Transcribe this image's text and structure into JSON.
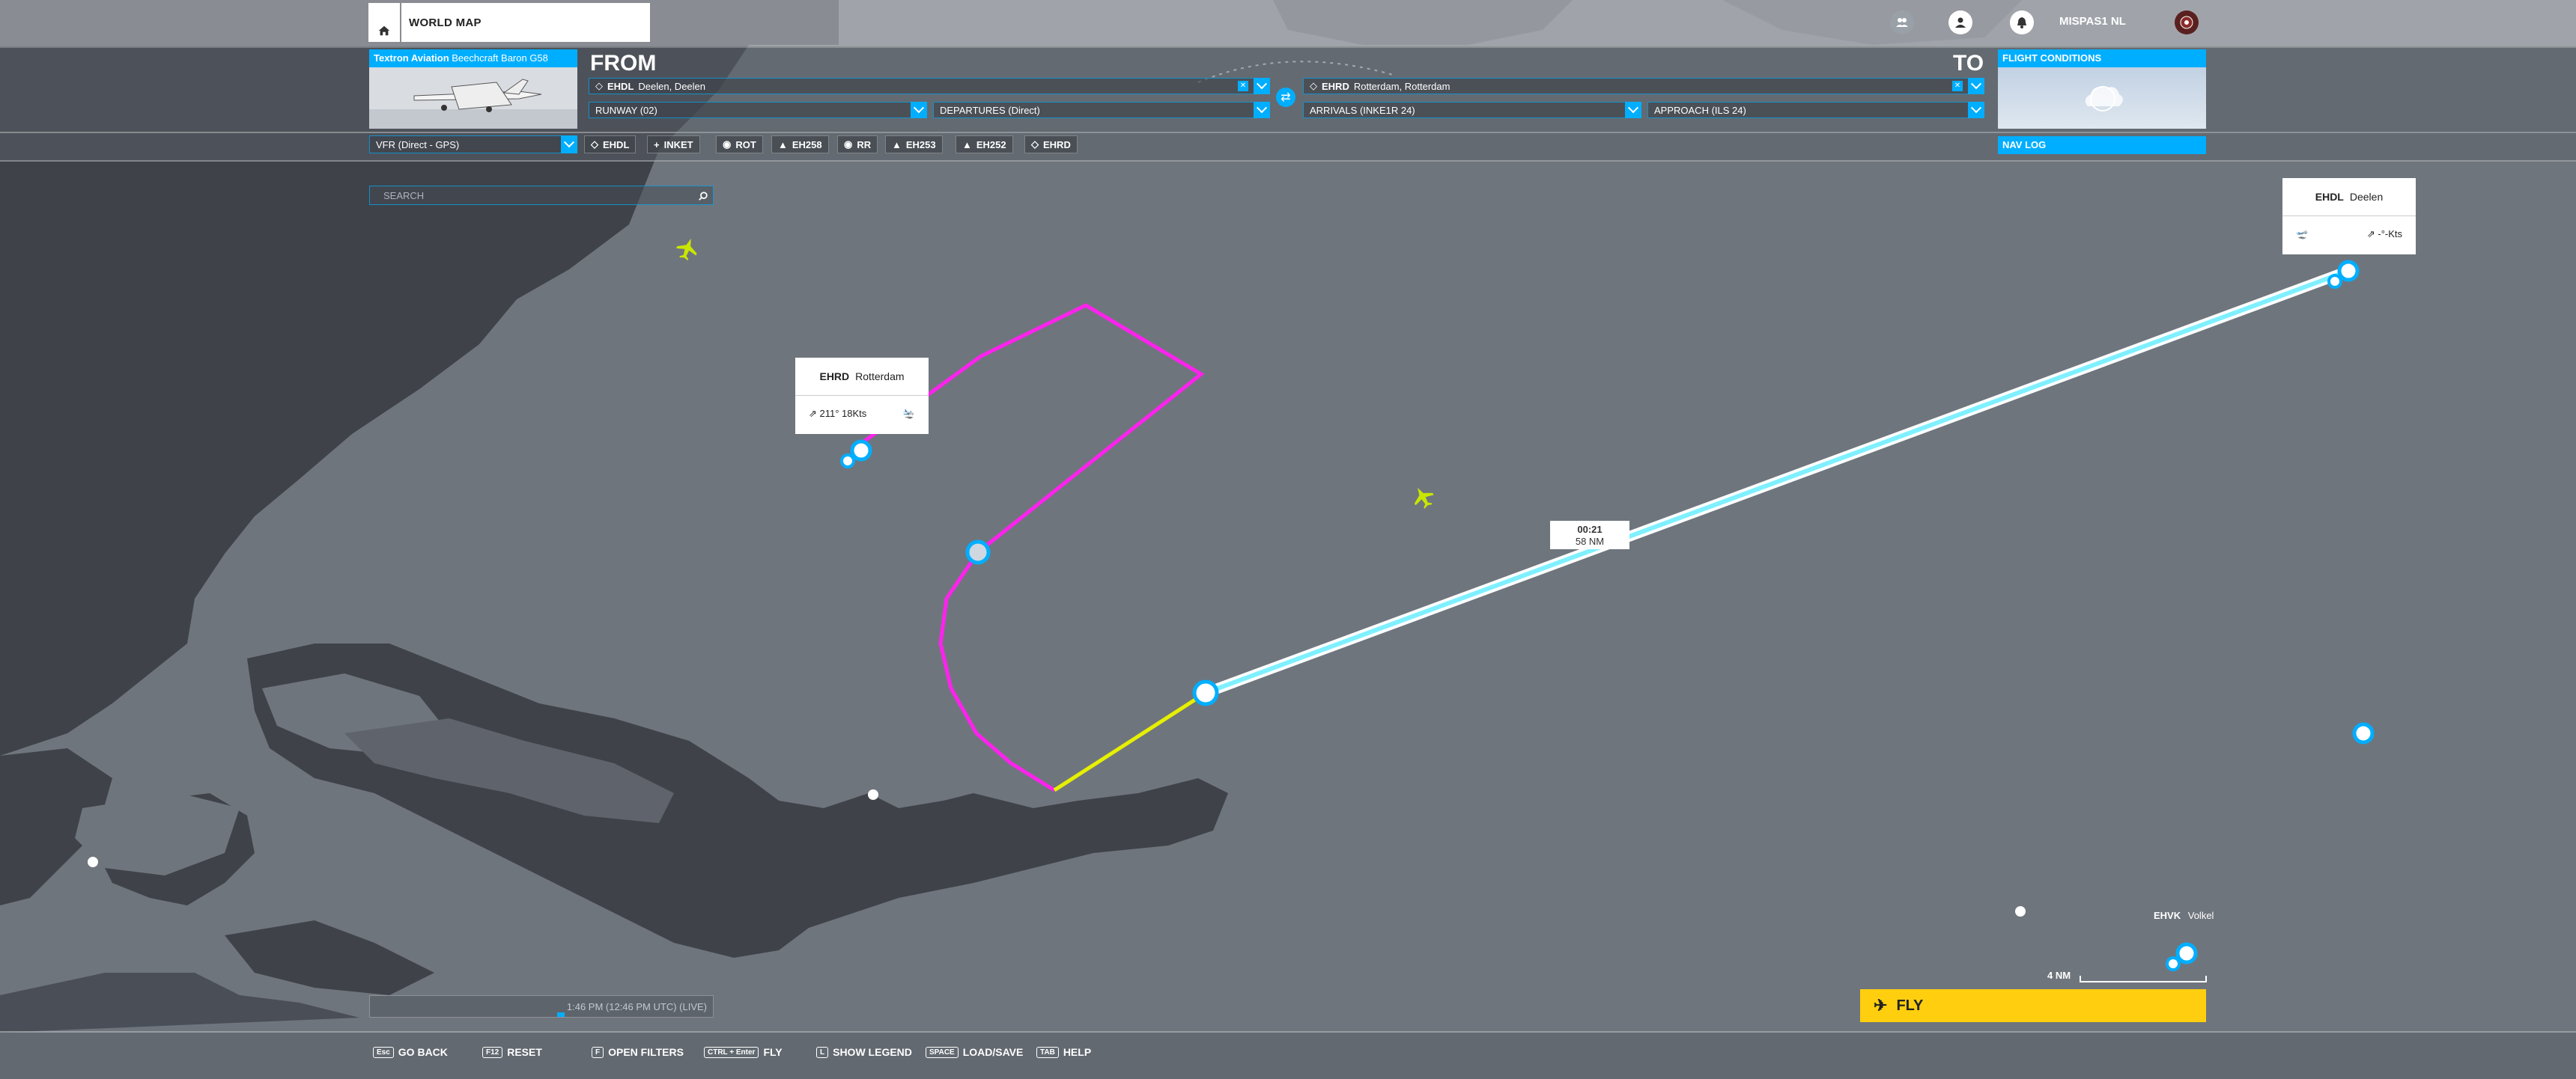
{
  "top": {
    "tab_label": "WORLD MAP",
    "pilot_name": "MISPAS1 NL"
  },
  "aircraft": {
    "maker": "Textron Aviation",
    "model": "Beechcraft Baron G58"
  },
  "from": {
    "title": "FROM",
    "airport_code": "EHDL",
    "airport_name": "Deelen, Deelen",
    "runway": "RUNWAY (02)",
    "departure": "DEPARTURES (Direct)"
  },
  "to": {
    "title": "TO",
    "airport_code": "EHRD",
    "airport_name": "Rotterdam, Rotterdam",
    "arrival": "ARRIVALS (INKE1R 24)",
    "approach": "APPROACH (ILS 24)"
  },
  "conditions": {
    "title": "FLIGHT CONDITIONS"
  },
  "navlog": {
    "title": "NAV LOG"
  },
  "flight_type": "VFR (Direct - GPS)",
  "waypoints": [
    "EHDL",
    "INKET",
    "ROT",
    "EH258",
    "RR",
    "EH253",
    "EH252",
    "EHRD"
  ],
  "search_placeholder": "SEARCH",
  "cards": {
    "deelen": {
      "code": "EHDL",
      "name": "Deelen",
      "wind": "-°-Kts"
    },
    "rotterdam": {
      "code": "EHRD",
      "name": "Rotterdam",
      "wind": "211° 18Kts"
    }
  },
  "leg": {
    "time": "00:21",
    "distance": "58 NM"
  },
  "ehvk": {
    "code": "EHVK",
    "name": "Volkel"
  },
  "scale_label": "4 NM",
  "fly_label": "FLY",
  "time_label": "1:46 PM (12:46 PM UTC) (LIVE)",
  "hints": [
    {
      "key": "Esc",
      "label": "GO BACK"
    },
    {
      "key": "F12",
      "label": "RESET"
    },
    {
      "key": "F",
      "label": "OPEN FILTERS"
    },
    {
      "key": "CTRL + Enter",
      "label": "FLY"
    },
    {
      "key": "L",
      "label": "SHOW LEGEND"
    },
    {
      "key": "SPACE",
      "label": "LOAD/SAVE"
    },
    {
      "key": "TAB",
      "label": "HELP"
    }
  ],
  "colors": {
    "accent": "#00aeff",
    "approach_route": "#ff22ee",
    "final_route": "#e6f000",
    "main_route": "#7ff0ff",
    "fly_button": "#ffcf0f"
  }
}
